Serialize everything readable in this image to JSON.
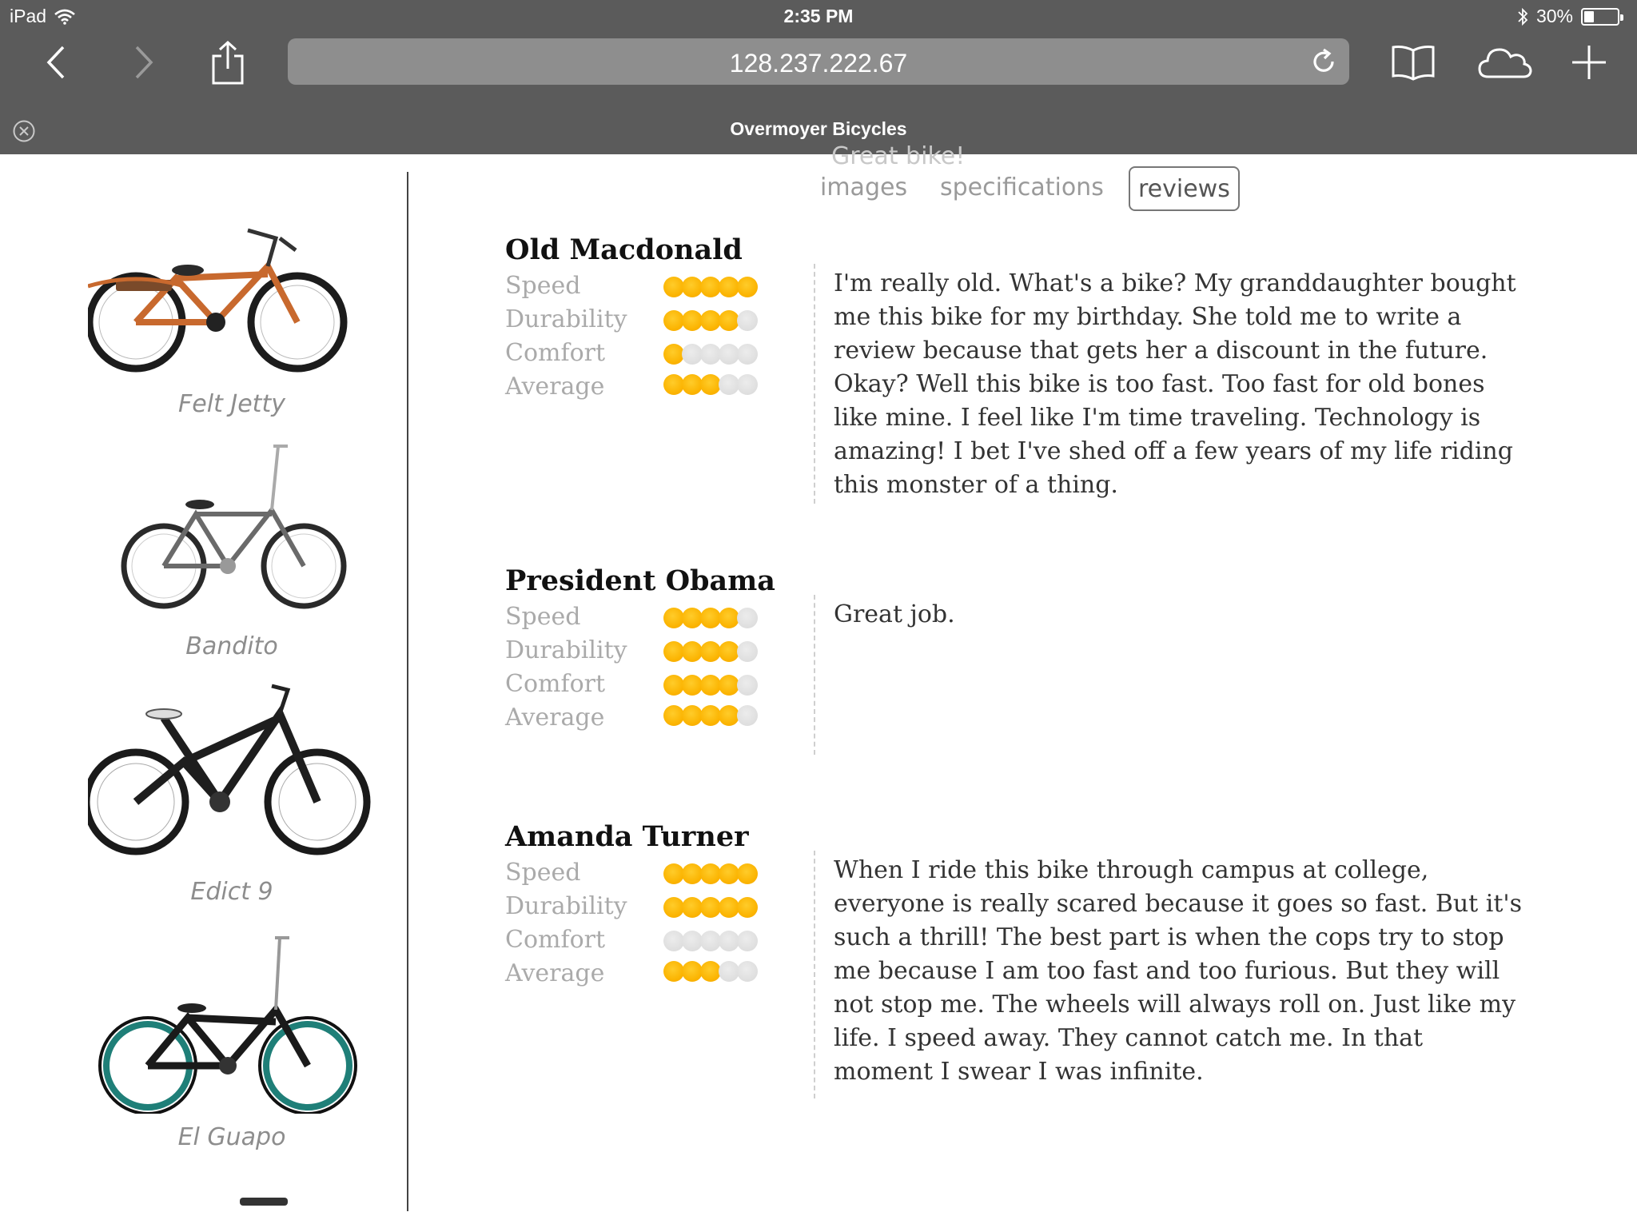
{
  "status_bar": {
    "device": "iPad",
    "time": "2:35 PM",
    "battery": "30%",
    "battery_level": 0.3
  },
  "browser": {
    "url": "128.237.222.67",
    "tab_title": "Overmoyer Bicycles"
  },
  "sidebar": {
    "bikes": [
      {
        "name": "Felt Jetty",
        "frame_color": "#c8692e",
        "tire_color": "#1c1c1c"
      },
      {
        "name": "Bandito",
        "frame_color": "#6a6a6a",
        "tire_color": "#2a2a2a"
      },
      {
        "name": "Edict 9",
        "frame_color": "#1e1e1e",
        "tire_color": "#1a1a1a"
      },
      {
        "name": "El Guapo",
        "frame_color": "#1a1a1a",
        "tire_color": "#1f7f78"
      }
    ]
  },
  "content": {
    "ghost_text": "Great bike!",
    "tabs": [
      "images",
      "specifications",
      "reviews"
    ],
    "active_tab": "reviews",
    "metric_labels": [
      "Speed",
      "Durability",
      "Comfort",
      "Average"
    ],
    "reviews": [
      {
        "reviewer": "Old Macdonald",
        "ratings": {
          "Speed": 5,
          "Durability": 4,
          "Comfort": 1,
          "Average": 3
        },
        "text": "I'm really old. What's a bike? My granddaughter bought me this bike for my birthday. She told me to write a review because that gets her a discount in the future. Okay? Well this bike is too fast. Too fast for old bones like mine. I feel like I'm time traveling. Technology is amazing! I bet I've shed off a few years of my life riding this monster of a thing."
      },
      {
        "reviewer": "President Obama",
        "ratings": {
          "Speed": 4,
          "Durability": 4,
          "Comfort": 4,
          "Average": 4
        },
        "text": "Great job."
      },
      {
        "reviewer": "Amanda Turner",
        "ratings": {
          "Speed": 5,
          "Durability": 5,
          "Comfort": 0,
          "Average": 3
        },
        "text": "When I ride this bike through campus at college, everyone is really scared because it goes so fast. But it's such a thrill! The best part is when the cops try to stop me because I am too fast and too furious. But they will not stop me. The wheels will always roll on. Just like my life. I speed away. They cannot catch me. In that moment I swear I was infinite."
      }
    ]
  },
  "colors": {
    "chrome": "#5b5b5b",
    "url_bar": "#8e8e8e",
    "star_on": "#fbb300",
    "star_off": "#dedede"
  }
}
